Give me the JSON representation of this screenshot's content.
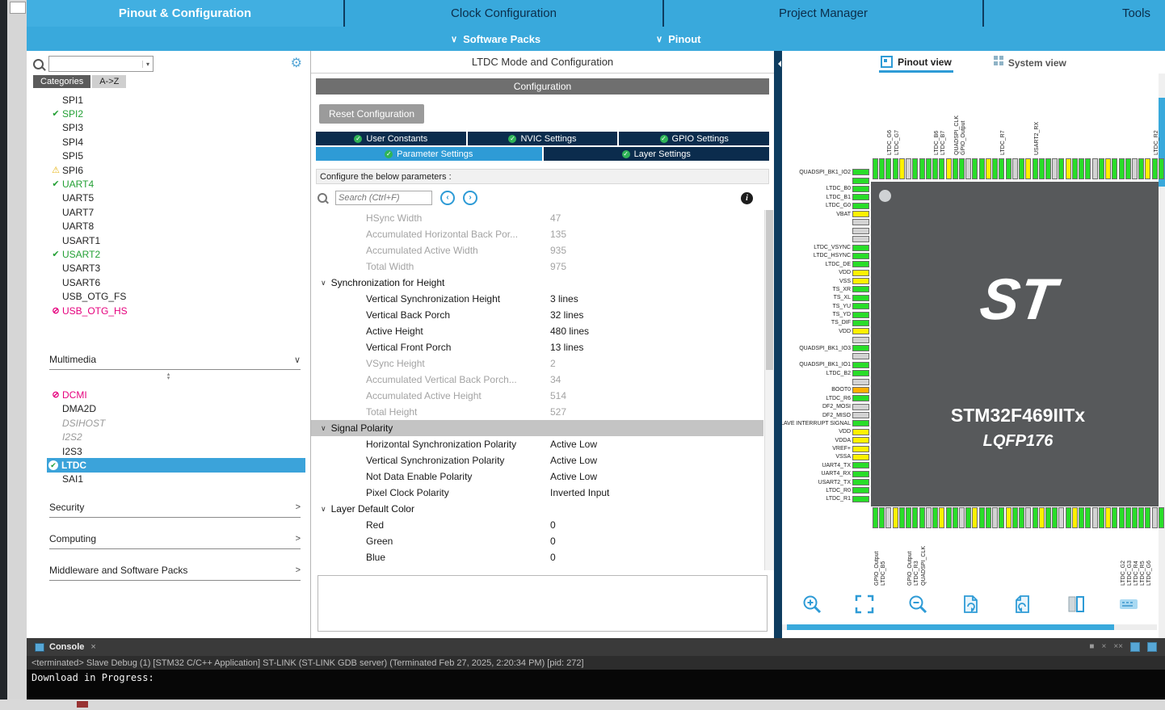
{
  "colors": {
    "accent_blue": "#39A9DC",
    "dark_navy": "#0B2C4D",
    "tab_active_blue": "#2E9BD6",
    "chip_gray": "#57595B",
    "pin_green": "#29DD29",
    "pin_yellow": "#FFF100",
    "pin_gray": "#D3D3D3",
    "pin_orange": "#FFAE00",
    "error_magenta": "#E5007D",
    "ok_green": "#24A035"
  },
  "topbar": {
    "tabs": [
      {
        "label": "Pinout & Configuration",
        "active": true
      },
      {
        "label": "Clock Configuration",
        "active": false
      },
      {
        "label": "Project Manager",
        "active": false
      },
      {
        "label": "Tools",
        "active": false
      }
    ]
  },
  "subbar": {
    "items": [
      "Software Packs",
      "Pinout"
    ]
  },
  "sidebar": {
    "search_value": "",
    "tabs": [
      {
        "label": "Categories",
        "active": true
      },
      {
        "label": "A->Z",
        "active": false
      }
    ],
    "items_top": [
      {
        "label": "SPI1",
        "state": "plain"
      },
      {
        "label": "SPI2",
        "state": "ok"
      },
      {
        "label": "SPI3",
        "state": "plain"
      },
      {
        "label": "SPI4",
        "state": "plain"
      },
      {
        "label": "SPI5",
        "state": "plain"
      },
      {
        "label": "SPI6",
        "state": "warn"
      },
      {
        "label": "UART4",
        "state": "ok"
      },
      {
        "label": "UART5",
        "state": "plain"
      },
      {
        "label": "UART7",
        "state": "plain"
      },
      {
        "label": "UART8",
        "state": "plain"
      },
      {
        "label": "USART1",
        "state": "plain"
      },
      {
        "label": "USART2",
        "state": "ok"
      },
      {
        "label": "USART3",
        "state": "plain"
      },
      {
        "label": "USART6",
        "state": "plain"
      },
      {
        "label": "USB_OTG_FS",
        "state": "plain"
      },
      {
        "label": "USB_OTG_HS",
        "state": "blocked"
      }
    ],
    "category_open": {
      "label": "Multimedia"
    },
    "items_multimedia": [
      {
        "label": "DCMI",
        "state": "blocked"
      },
      {
        "label": "DMA2D",
        "state": "plain"
      },
      {
        "label": "DSIHOST",
        "state": "disabled"
      },
      {
        "label": "I2S2",
        "state": "disabled"
      },
      {
        "label": "I2S3",
        "state": "plain"
      },
      {
        "label": "LTDC",
        "state": "selected"
      },
      {
        "label": "SAI1",
        "state": "plain"
      }
    ],
    "categories_collapsed": [
      "Security",
      "Computing",
      "Middleware and Software Packs"
    ]
  },
  "main": {
    "title": "LTDC Mode and Configuration",
    "config_label": "Configuration",
    "reset_button": "Reset Configuration",
    "tabs_row1": [
      "User Constants",
      "NVIC Settings",
      "GPIO Settings"
    ],
    "tabs_row2": [
      {
        "label": "Parameter Settings",
        "active": true
      },
      {
        "label": "Layer Settings",
        "active": false
      }
    ],
    "configure_hint": "Configure the below parameters :",
    "search_placeholder": "Search (Ctrl+F)",
    "parameters": [
      {
        "kind": "row",
        "label": "HSync Width",
        "value": "47",
        "readonly": true
      },
      {
        "kind": "row",
        "label": "Accumulated Horizontal Back Por...",
        "value": "135",
        "readonly": true
      },
      {
        "kind": "row",
        "label": "Accumulated Active Width",
        "value": "935",
        "readonly": true
      },
      {
        "kind": "row",
        "label": "Total Width",
        "value": "975",
        "readonly": true
      },
      {
        "kind": "section",
        "label": "Synchronization for Height"
      },
      {
        "kind": "row",
        "label": "Vertical Synchronization Height",
        "value": "3 lines",
        "readonly": false
      },
      {
        "kind": "row",
        "label": "Vertical Back Porch",
        "value": "32 lines",
        "readonly": false
      },
      {
        "kind": "row",
        "label": "Active Height",
        "value": "480 lines",
        "readonly": false
      },
      {
        "kind": "row",
        "label": "Vertical Front Porch",
        "value": "13 lines",
        "readonly": false
      },
      {
        "kind": "row",
        "label": "VSync Height",
        "value": "2",
        "readonly": true
      },
      {
        "kind": "row",
        "label": "Accumulated Vertical Back Porch...",
        "value": "34",
        "readonly": true
      },
      {
        "kind": "row",
        "label": "Accumulated Active Height",
        "value": "514",
        "readonly": true
      },
      {
        "kind": "row",
        "label": "Total Height",
        "value": "527",
        "readonly": true
      },
      {
        "kind": "section-selected",
        "label": "Signal Polarity"
      },
      {
        "kind": "row",
        "label": "Horizontal Synchronization Polarity",
        "value": "Active Low",
        "readonly": false
      },
      {
        "kind": "row",
        "label": "Vertical Synchronization Polarity",
        "value": "Active Low",
        "readonly": false
      },
      {
        "kind": "row",
        "label": "Not Data Enable Polarity",
        "value": "Active Low",
        "readonly": false
      },
      {
        "kind": "row",
        "label": "Pixel Clock Polarity",
        "value": "Inverted Input",
        "readonly": false
      },
      {
        "kind": "section",
        "label": "Layer Default Color"
      },
      {
        "kind": "row",
        "label": "Red",
        "value": "0",
        "readonly": false
      },
      {
        "kind": "row",
        "label": "Green",
        "value": "0",
        "readonly": false
      },
      {
        "kind": "row",
        "label": "Blue",
        "value": "0",
        "readonly": false
      }
    ]
  },
  "pinout": {
    "tabs": [
      {
        "label": "Pinout view",
        "active": true
      },
      {
        "label": "System view",
        "active": false
      }
    ],
    "logo": "ST",
    "chip_name": "STM32F469IITx",
    "package": "LQFP176",
    "left_pins": [
      "g:QUADSPI_BK1_IO2",
      "g:",
      "g:LTDC_B0",
      "g:LTDC_B1",
      "g:LTDC_G0",
      "y:VBAT",
      "x:",
      "x:",
      "x:",
      "g:LTDC_VSYNC",
      "g:LTDC_HSYNC",
      "g:LTDC_DE",
      "y:VDD",
      "y:VSS",
      "g:TS_XR",
      "g:TS_XL",
      "g:TS_YU",
      "g:TS_YD",
      "g:TS_DIF",
      "y:VDD",
      "x:",
      "g:QUADSPI_BK1_IO3",
      "x:",
      "g:QUADSPI_BK1_IO1",
      "g:LTDC_B2",
      "x:",
      "o:BOOT0",
      "g:LTDC_R6",
      "x:DF2_MOSI",
      "x:DF2_MISO",
      "g:SLAVE INTERRUPT SIGNAL",
      "y:VDD",
      "y:VDDA",
      "y:VREF+",
      "y:VSSA",
      "g:UART4_TX",
      "g:UART4_RX",
      "g:USART2_TX",
      "g:LTDC_R0",
      "g:LTDC_R1"
    ],
    "top_pins": [
      "g:",
      "g:",
      "g:LTDC_G6",
      "g:LTDC_G7",
      "y:",
      "x:",
      "g:",
      "g:",
      "g:",
      "g:LTDC_B6",
      "g:LTDC_B7",
      "y:",
      "g:QUADSPI_CLK",
      "g:GPIO_Output",
      "x:",
      "g:",
      "g:",
      "y:",
      "g:",
      "g:LTDC_R7",
      "g:",
      "x:",
      "g:",
      "y:",
      "g:USART2_RX",
      "g:",
      "g:",
      "x:",
      "g:",
      "y:",
      "g:",
      "g:",
      "g:",
      "x:",
      "g:",
      "y:",
      "g:",
      "g:",
      "g:",
      "x:",
      "g:",
      "y:",
      "g:LTDC_R2",
      "g:"
    ],
    "bottom_pins": [
      "g:GPIO_Output",
      "g:LTDC_B5",
      "x:",
      "y:",
      "g:",
      "g:GPIO_Output",
      "g:LTDC_R3",
      "g:QUADSPI_CLK",
      "x:",
      "g:",
      "y:",
      "g:",
      "g:",
      "x:",
      "g:",
      "y:",
      "g:",
      "g:",
      "x:",
      "g:",
      "y:",
      "g:",
      "g:",
      "x:",
      "g:",
      "y:",
      "g:",
      "g:",
      "x:",
      "g:",
      "y:",
      "g:",
      "g:",
      "x:",
      "g:",
      "y:",
      "g:",
      "g:LTDC_G2",
      "g:LTDC_G3",
      "g:LTDC_R4",
      "g:LTDC_R5",
      "g:LTDC_G6",
      "x:",
      "g:"
    ],
    "toolbar": [
      "zoom-in",
      "best-fit",
      "zoom-out",
      "rotate-clockwise",
      "rotate-counterclockwise",
      "mark-pins",
      "show-legend"
    ]
  },
  "console": {
    "tab_label": "Console",
    "status_line": "<terminated> Slave Debug (1) [STM32 C/C++ Application] ST-LINK (ST-LINK GDB server) (Terminated Feb 27, 2025, 2:20:34 PM) [pid: 272]",
    "output": "Download in Progress:"
  }
}
